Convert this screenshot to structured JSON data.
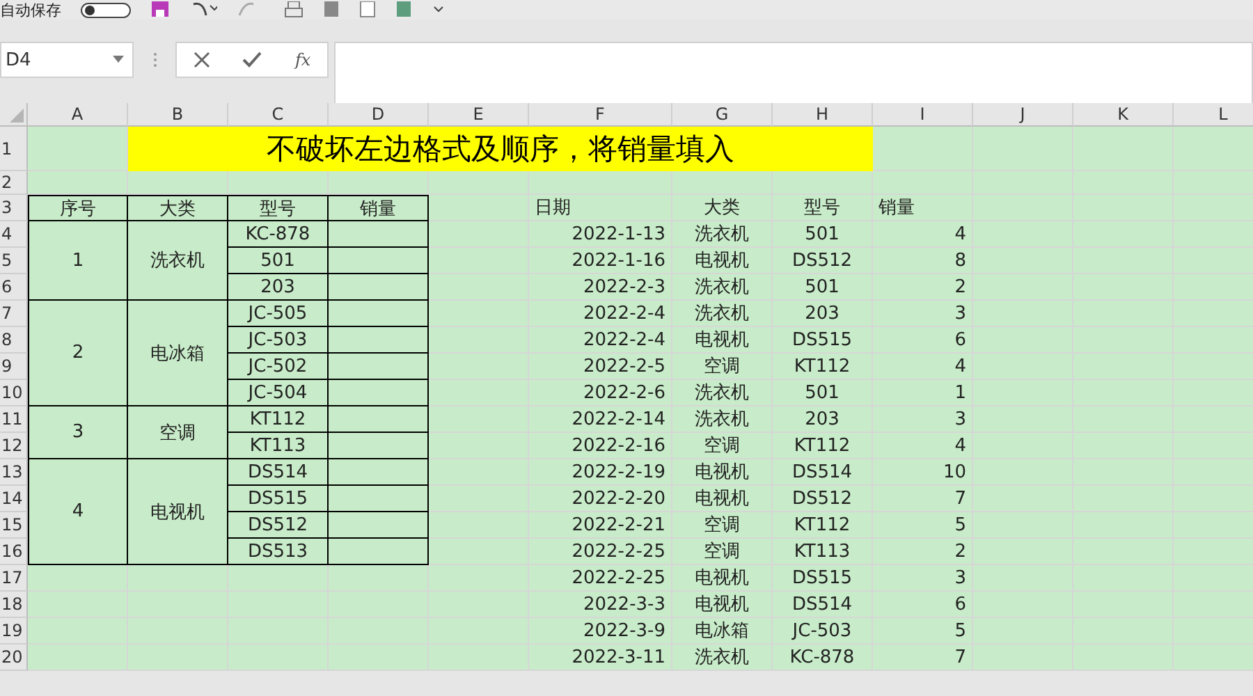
{
  "toolbar": {
    "autosave_label": "自动保存",
    "autosave_on": false
  },
  "name_box": {
    "value": "D4"
  },
  "formula_bar": {
    "fx_label": "fx"
  },
  "column_headers": [
    "A",
    "B",
    "C",
    "D",
    "E",
    "F",
    "G",
    "H",
    "I",
    "J",
    "K",
    "L"
  ],
  "row_headers": [
    "1",
    "2",
    "3",
    "4",
    "5",
    "6",
    "7",
    "8",
    "9",
    "10",
    "11",
    "12",
    "13",
    "14",
    "15",
    "16",
    "17",
    "18",
    "19",
    "20"
  ],
  "title": "不破坏左边格式及顺序，将销量填入",
  "left_table": {
    "headers": [
      "序号",
      "大类",
      "型号",
      "销量"
    ],
    "groups": [
      {
        "index": "1",
        "category": "洗衣机",
        "models": [
          "KC-878",
          "501",
          "203"
        ]
      },
      {
        "index": "2",
        "category": "电冰箱",
        "models": [
          "JC-505",
          "JC-503",
          "JC-502",
          "JC-504"
        ]
      },
      {
        "index": "3",
        "category": "空调",
        "models": [
          "KT112",
          "KT113"
        ]
      },
      {
        "index": "4",
        "category": "电视机",
        "models": [
          "DS514",
          "DS515",
          "DS512",
          "DS513"
        ]
      }
    ]
  },
  "right_table": {
    "headers": [
      "日期",
      "大类",
      "型号",
      "销量"
    ],
    "rows": [
      {
        "date": "2022-1-13",
        "category": "洗衣机",
        "model": "501",
        "qty": "4"
      },
      {
        "date": "2022-1-16",
        "category": "电视机",
        "model": "DS512",
        "qty": "8"
      },
      {
        "date": "2022-2-3",
        "category": "洗衣机",
        "model": "501",
        "qty": "2"
      },
      {
        "date": "2022-2-4",
        "category": "洗衣机",
        "model": "203",
        "qty": "3"
      },
      {
        "date": "2022-2-4",
        "category": "电视机",
        "model": "DS515",
        "qty": "6"
      },
      {
        "date": "2022-2-5",
        "category": "空调",
        "model": "KT112",
        "qty": "4"
      },
      {
        "date": "2022-2-6",
        "category": "洗衣机",
        "model": "501",
        "qty": "1"
      },
      {
        "date": "2022-2-14",
        "category": "洗衣机",
        "model": "203",
        "qty": "3"
      },
      {
        "date": "2022-2-16",
        "category": "空调",
        "model": "KT112",
        "qty": "4"
      },
      {
        "date": "2022-2-19",
        "category": "电视机",
        "model": "DS514",
        "qty": "10"
      },
      {
        "date": "2022-2-20",
        "category": "电视机",
        "model": "DS512",
        "qty": "7"
      },
      {
        "date": "2022-2-21",
        "category": "空调",
        "model": "KT112",
        "qty": "5"
      },
      {
        "date": "2022-2-25",
        "category": "空调",
        "model": "KT113",
        "qty": "2"
      },
      {
        "date": "2022-2-25",
        "category": "电视机",
        "model": "DS515",
        "qty": "3"
      },
      {
        "date": "2022-3-3",
        "category": "电视机",
        "model": "DS514",
        "qty": "6"
      },
      {
        "date": "2022-3-9",
        "category": "电冰箱",
        "model": "JC-503",
        "qty": "5"
      },
      {
        "date": "2022-3-11",
        "category": "洗衣机",
        "model": "KC-878",
        "qty": "7"
      }
    ]
  }
}
